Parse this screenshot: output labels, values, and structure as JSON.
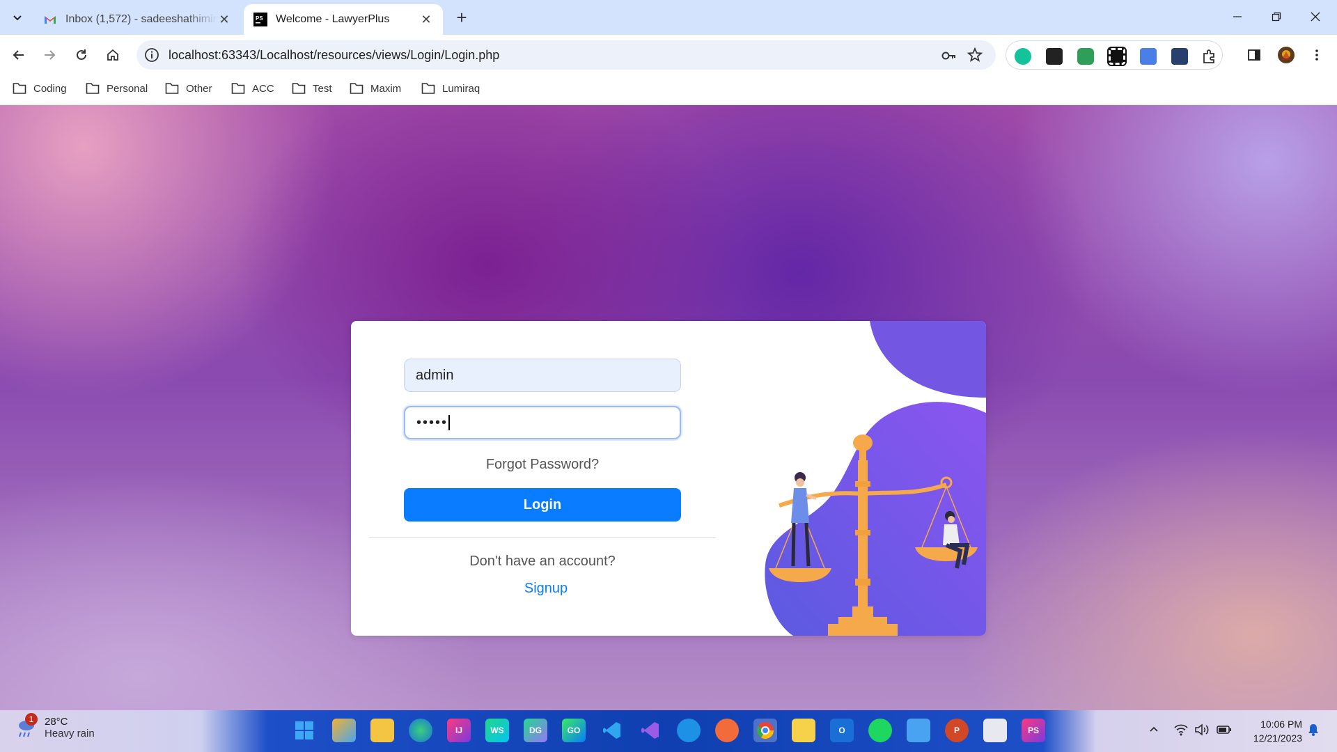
{
  "browser": {
    "tabs": [
      {
        "title": "Inbox (1,572) - sadeeshathimira",
        "active": false,
        "icon": "gmail-icon"
      },
      {
        "title": "Welcome - LawyerPlus",
        "active": true,
        "icon": "phpstorm-icon"
      }
    ],
    "address": "localhost:63343/Localhost/resources/views/Login/Login.php",
    "bookmarks": [
      "Coding",
      "Personal",
      "Other",
      "ACC",
      "Test",
      "Maxim",
      "Lumiraq"
    ]
  },
  "login": {
    "username_value": "admin",
    "password_masked": "•••••",
    "forgot_label": "Forgot Password?",
    "login_label": "Login",
    "no_account_label": "Don't have an account?",
    "signup_label": "Signup"
  },
  "colors": {
    "primary": "#0a7cff",
    "illustration_purple": "#7b5ce6",
    "illustration_gold": "#f5a94a"
  },
  "taskbar": {
    "weather_temp": "28°C",
    "weather_condition": "Heavy rain",
    "weather_badge": "1",
    "time": "10:06 PM",
    "date": "12/21/2023"
  }
}
